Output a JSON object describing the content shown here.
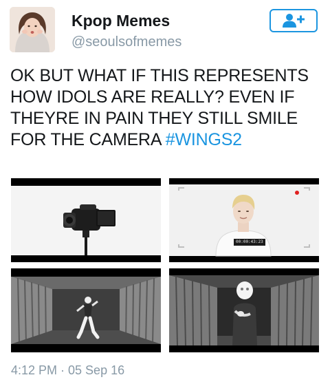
{
  "user": {
    "display_name": "Kpop Memes",
    "handle": "@seoulsofmemes"
  },
  "follow_button": {
    "icon": "follow-user-plus-icon",
    "color": "#1b95e0"
  },
  "tweet": {
    "text": "OK BUT WHAT IF THIS REPRESENTS HOW IDOLS ARE REALLY? EVEN IF THEYRE IN PAIN THEY STILL SMILE FOR THE CAMERA ",
    "hashtag": "#WINGS2",
    "timestamp": "4:12 PM · 05 Sep 16"
  },
  "media": {
    "recording_timecode": "00:00:43:23"
  },
  "colors": {
    "link": "#1b95e0",
    "muted": "#8899a6",
    "text": "#14171a"
  }
}
